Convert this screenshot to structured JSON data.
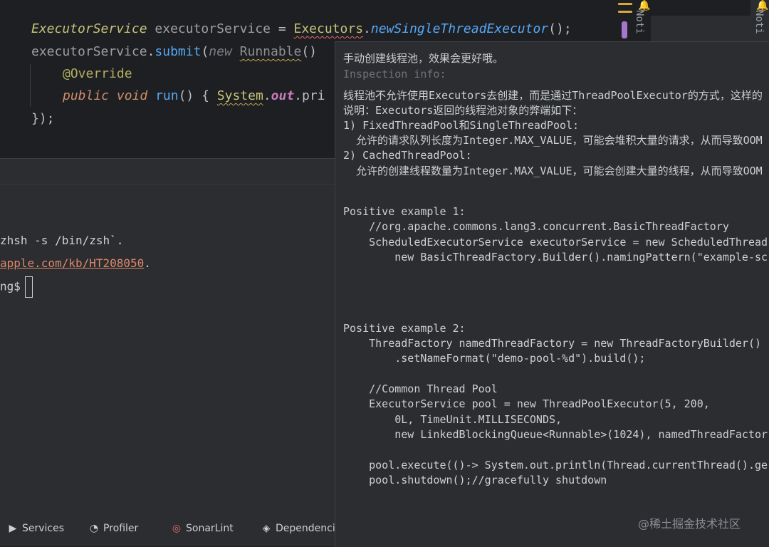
{
  "editor": {
    "line1": {
      "type": "ExecutorService",
      "var": "executorService",
      "eq": "=",
      "cls": "Executors",
      "dot": ".",
      "method": "newSingleThreadExecutor",
      "end": "();"
    },
    "line2": {
      "var": "executorService",
      "dot": ".",
      "method": "submit",
      "paren": "(",
      "kw": "new",
      "cls": "Runnable",
      "end": "()"
    },
    "line3": {
      "ann": "@Override"
    },
    "line4": {
      "kw": "public void",
      "method": "run",
      "mid": "() {",
      "cls": "System",
      "dot": ".",
      "field": "out",
      "tail": ".pri"
    },
    "line5": {
      "text": "});"
    }
  },
  "right_strip": {
    "notifications_label": "Noti"
  },
  "terminal": {
    "line1": "zhsh -s /bin/zsh`.",
    "line2_link": "apple.com/kb/HT208050",
    "line2_tail": ".",
    "line3": "ng$"
  },
  "bottom_bar": {
    "items": [
      {
        "label": "Services",
        "icon": "services-icon"
      },
      {
        "label": "Profiler",
        "icon": "profiler-icon"
      },
      {
        "label": "SonarLint",
        "icon": "sonarlint-icon"
      },
      {
        "label": "Dependenci",
        "icon": "dependencies-icon"
      }
    ]
  },
  "popup": {
    "heading": "手动创建线程池，效果会更好哦。",
    "info_label": "Inspection info:",
    "desc1": "线程池不允许使用Executors去创建，而是通过ThreadPoolExecutor的方式，这样的",
    "desc2": "说明：Executors返回的线程池对象的弊端如下：",
    "desc3": "1) FixedThreadPool和SingleThreadPool:",
    "desc4": "  允许的请求队列长度为Integer.MAX_VALUE，可能会堆积大量的请求，从而导致OOM",
    "desc5": "2) CachedThreadPool:",
    "desc6": "  允许的创建线程数量为Integer.MAX_VALUE，可能会创建大量的线程，从而导致OOM",
    "ex1_title": "Positive example 1:",
    "ex1_l1": "    //org.apache.commons.lang3.concurrent.BasicThreadFactory",
    "ex1_l2": "    ScheduledExecutorService executorService = new ScheduledThread",
    "ex1_l3": "        new BasicThreadFactory.Builder().namingPattern(\"example-sc",
    "ex2_title": "Positive example 2:",
    "ex2_l1": "    ThreadFactory namedThreadFactory = new ThreadFactoryBuilder()",
    "ex2_l2": "        .setNameFormat(\"demo-pool-%d\").build();",
    "ex2_l3": "    //Common Thread Pool",
    "ex2_l4": "    ExecutorService pool = new ThreadPoolExecutor(5, 200,",
    "ex2_l5": "        0L, TimeUnit.MILLISECONDS,",
    "ex2_l6": "        new LinkedBlockingQueue<Runnable>(1024), namedThreadFactor",
    "ex2_l7": "    pool.execute(()-> System.out.println(Thread.currentThread().ge",
    "ex2_l8": "    pool.shutdown();//gracefully shutdown"
  },
  "watermark": "@稀土掘金技术社区"
}
